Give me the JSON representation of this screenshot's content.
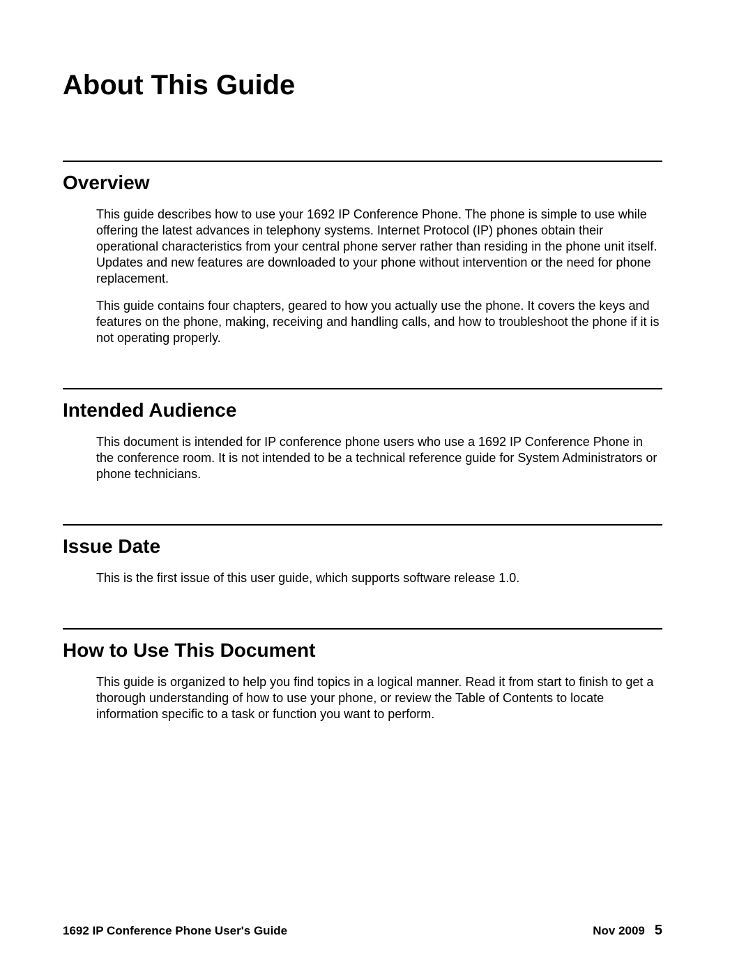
{
  "chapter_title": "About This Guide",
  "sections": [
    {
      "heading": "Overview",
      "paragraphs": [
        "This guide describes how to use your 1692 IP Conference Phone. The phone is simple to use while offering the latest advances in telephony systems. Internet Protocol (IP) phones obtain their operational characteristics from your central phone server rather than residing in the phone unit itself. Updates and new features are downloaded to your phone without intervention or the need for phone replacement.",
        "This guide contains four chapters, geared to how you actually use the phone. It covers the keys and features on the phone, making, receiving and handling calls, and how to troubleshoot the phone if it is not operating properly."
      ]
    },
    {
      "heading": "Intended Audience",
      "paragraphs": [
        "This document is intended for IP conference phone users who use a 1692 IP Conference Phone in the conference room. It is not intended to be a technical reference guide for System Administrators or phone technicians."
      ]
    },
    {
      "heading": "Issue Date",
      "paragraphs": [
        "This is the first issue of this user guide, which supports software release 1.0."
      ]
    },
    {
      "heading": "How to Use This Document",
      "paragraphs": [
        "This guide is organized to help you find topics in a logical manner. Read it from start to finish to get a thorough understanding of how to use your phone, or review the Table of Contents to locate information specific to a task or function you want to perform."
      ]
    }
  ],
  "footer": {
    "doc_title": "1692 IP Conference Phone User's Guide",
    "date": "Nov 2009",
    "page": "5"
  }
}
